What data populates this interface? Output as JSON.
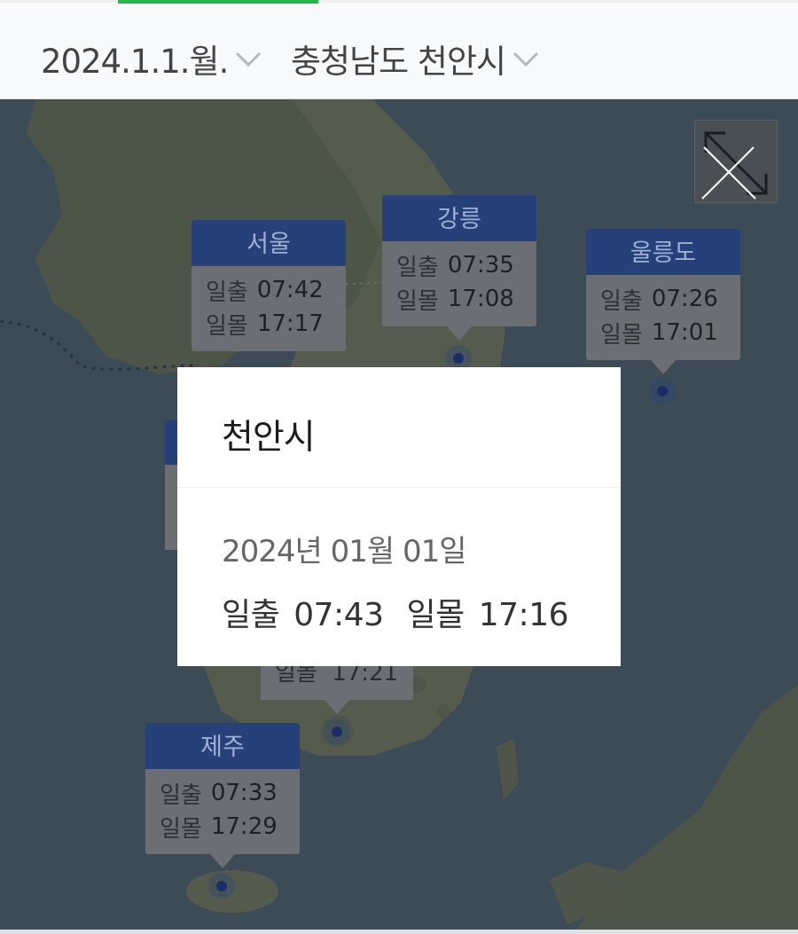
{
  "header": {
    "date_selector": "2024.1.1.월.",
    "region_selector": "충청남도 천안시"
  },
  "colors": {
    "tab_indicator": "#21b94a",
    "marker_header": "#26407a",
    "marker_body": "#6b6e72",
    "map_sea": "#3d4b57"
  },
  "icons": {
    "chevron": "chevron-down-icon",
    "expand": "expand-arrows-icon"
  },
  "markers": [
    {
      "city": "서울",
      "sunrise_label": "일출",
      "sunrise": "07:42",
      "sunset_label": "일몰",
      "sunset": "17:17"
    },
    {
      "city": "강릉",
      "sunrise_label": "일출",
      "sunrise": "07:35",
      "sunset_label": "일몰",
      "sunset": "17:08"
    },
    {
      "city": "울릉도",
      "sunrise_label": "일출",
      "sunrise": "07:26",
      "sunset_label": "일몰",
      "sunset": "17:01"
    },
    {
      "city": "제주",
      "sunrise_label": "일출",
      "sunrise": "07:33",
      "sunset_label": "일몰",
      "sunset": "17:29"
    }
  ],
  "partial_marker": {
    "sunset_label": "일몰",
    "sunset": "17:21"
  },
  "popup": {
    "title": "천안시",
    "date": "2024년 01월 01일",
    "sunrise_label": "일출",
    "sunrise": "07:43",
    "sunset_label": "일몰",
    "sunset": "17:16"
  }
}
